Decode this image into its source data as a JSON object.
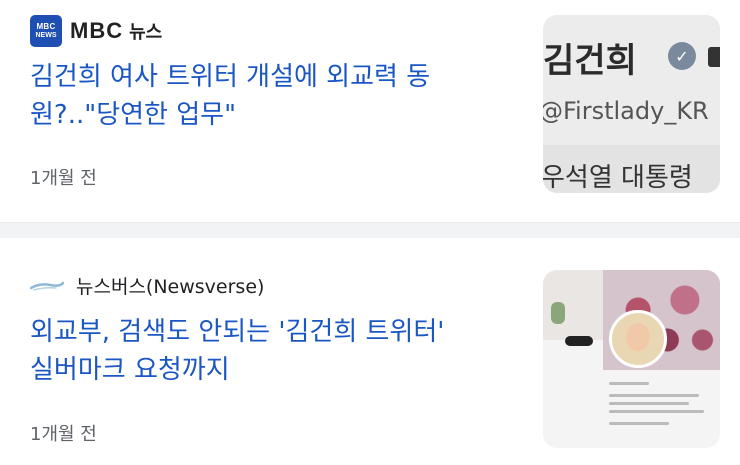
{
  "articles": [
    {
      "source": {
        "logo_line1": "MBC",
        "logo_line2": "NEWS",
        "wordmark": "MBC",
        "wordmark_suffix": "뉴스"
      },
      "title_line1": "김건희 여사 트위터 개설에 외교력 동",
      "title_line2": "원?..\"당연한 업무\"",
      "time": "1개월 전",
      "thumbnail": {
        "name": "김건희",
        "handle": "@Firstlady_KR",
        "caption": "우석열 대통령"
      }
    },
    {
      "source": {
        "name": "뉴스버스(Newsverse)"
      },
      "title_line1": "외교부, 검색도 안되는 '김건희 트위터'",
      "title_line2": "실버마크 요청까지",
      "time": "1개월 전"
    }
  ],
  "colors": {
    "title": "#1a56c4",
    "mbc_logo": "#1f4fb3",
    "divider": "#f1f3f4"
  }
}
